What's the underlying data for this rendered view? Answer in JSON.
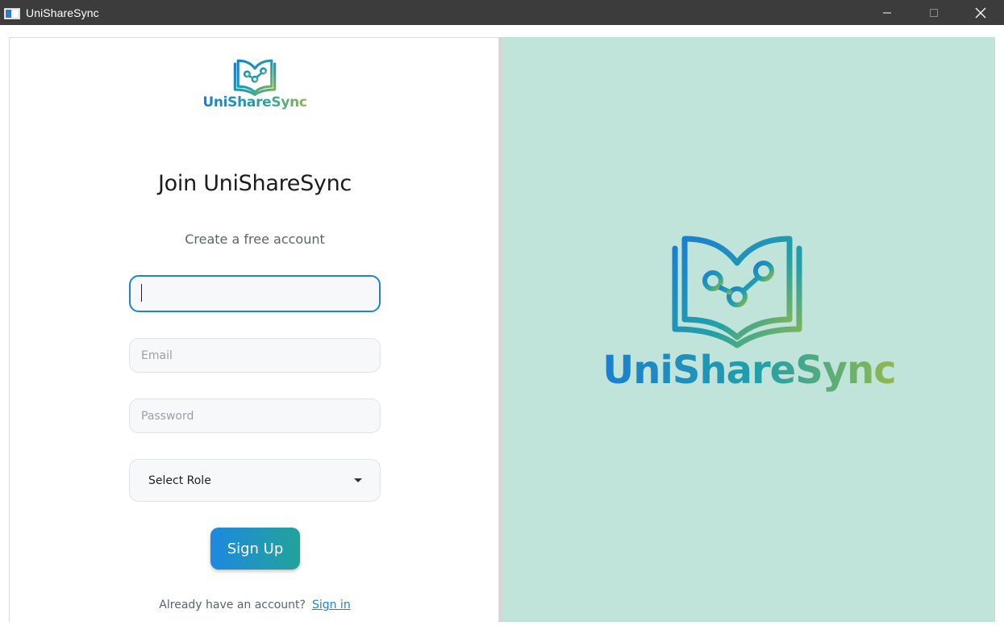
{
  "window": {
    "title": "UniShareSync"
  },
  "brand": {
    "name": "UniShareSync",
    "gradient_start": "#1b7fd0",
    "gradient_mid": "#23a0a8",
    "gradient_end": "#8db84a",
    "logo_icon": "book-network-icon"
  },
  "form": {
    "heading": "Join UniShareSync",
    "subheading": "Create a free account",
    "name_value": "",
    "email_placeholder": "Email",
    "password_placeholder": "Password",
    "role_label": "Select Role",
    "signup_label": "Sign Up",
    "signin_prompt": "Already have an account?",
    "signin_link": "Sign in"
  },
  "colors": {
    "accent": "#1f82d6",
    "right_panel_bg": "#c1e4da",
    "titlebar_bg": "#3c3c3c"
  }
}
